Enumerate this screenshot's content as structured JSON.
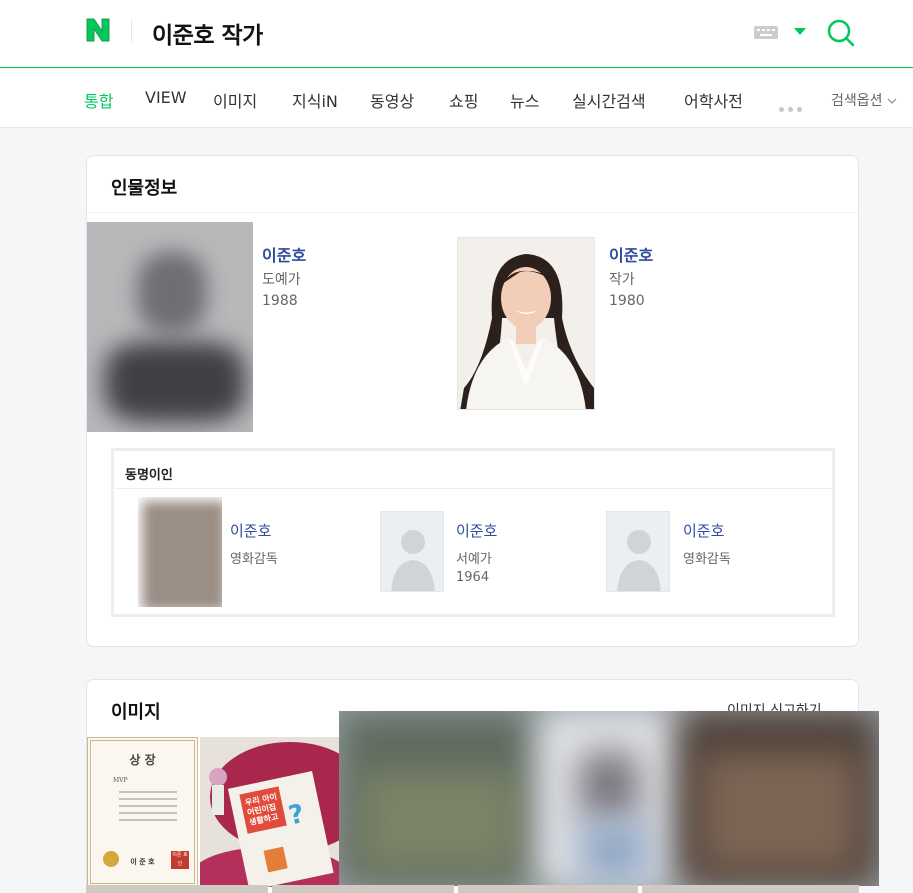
{
  "header": {
    "query": "이준호 작가",
    "brand_color": "#03c75a",
    "keyboard_icon": "keyboard-icon",
    "search_icon": "search-icon"
  },
  "tabs": [
    {
      "label": "통합",
      "active": true
    },
    {
      "label": "VIEW"
    },
    {
      "label": "이미지"
    },
    {
      "label": "지식iN"
    },
    {
      "label": "동영상"
    },
    {
      "label": "쇼핑"
    },
    {
      "label": "뉴스"
    },
    {
      "label": "실시간검색"
    },
    {
      "label": "어학사전"
    }
  ],
  "search_options": "검색옵션",
  "people": {
    "title": "인물정보",
    "main": [
      {
        "name": "이준호",
        "job": "도예가",
        "year": "1988"
      },
      {
        "name": "이준호",
        "job": "작가",
        "year": "1980"
      }
    ],
    "same_name": {
      "title": "동명이인",
      "items": [
        {
          "name": "이준호",
          "job": "영화감독",
          "year": ""
        },
        {
          "name": "이준호",
          "job": "서예가",
          "year": "1964"
        },
        {
          "name": "이준호",
          "job": "영화감독",
          "year": ""
        }
      ]
    }
  },
  "images": {
    "title": "이미지",
    "report": "이미지 신고하기",
    "certificate": {
      "title": "상 장",
      "mvp": "MVP",
      "name": "이 준 호",
      "seal": "이준 호인"
    },
    "book": {
      "line1": "우리 아이",
      "line2": "어린이집",
      "line3": "생활하고"
    }
  }
}
